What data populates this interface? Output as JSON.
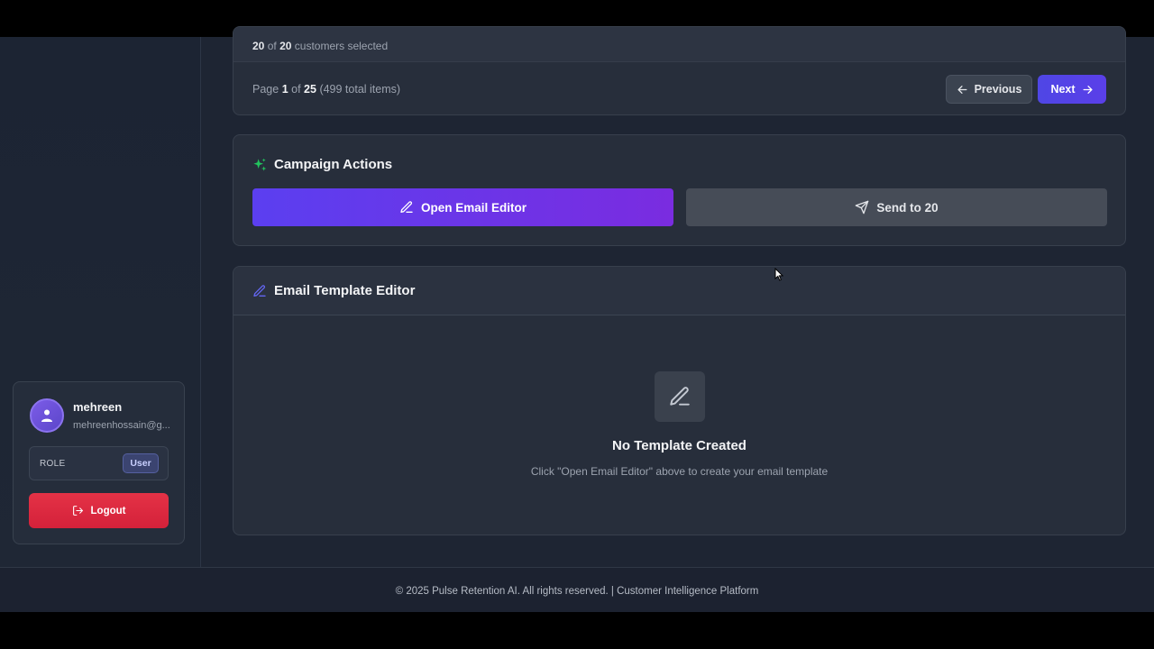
{
  "pagination": {
    "selected_count": "20",
    "selected_of": "of",
    "selected_total": "20",
    "selected_suffix": "customers selected",
    "page_prefix": "Page",
    "page_current": "1",
    "page_of": "of",
    "page_total": "25",
    "page_items": "(499 total items)",
    "previous_label": "Previous",
    "next_label": "Next"
  },
  "campaign": {
    "title": "Campaign Actions",
    "open_editor_label": "Open Email Editor",
    "send_label": "Send to 20",
    "accent_color": "#22c55e"
  },
  "editor": {
    "title": "Email Template Editor",
    "empty_title": "No Template Created",
    "empty_subtitle": "Click \"Open Email Editor\" above to create your email template"
  },
  "user": {
    "name": "mehreen",
    "email": "mehreenhossain@g...",
    "role_label": "ROLE",
    "role_value": "User",
    "logout_label": "Logout"
  },
  "footer": {
    "text": "© 2025 Pulse Retention AI. All rights reserved. | Customer Intelligence Platform"
  },
  "icons": {
    "campaign": "sparkles-icon",
    "editor": "pencil-icon",
    "send": "send-icon",
    "previous": "arrow-left-icon",
    "next": "arrow-right-icon",
    "logout": "logout-icon",
    "avatar": "user-icon"
  }
}
